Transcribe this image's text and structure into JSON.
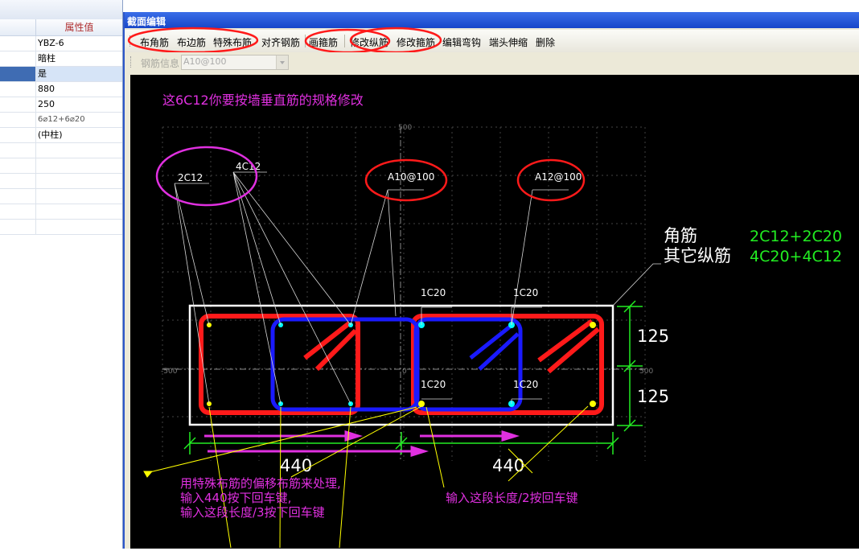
{
  "property_panel": {
    "header_value": "属性值",
    "rows": [
      {
        "value": "YBZ-6",
        "selected": false
      },
      {
        "value": "暗柱",
        "selected": false
      },
      {
        "value": "是",
        "selected": true
      },
      {
        "value": "880",
        "selected": false
      },
      {
        "value": "250",
        "selected": false
      },
      {
        "value": "6⌀12+6⌀20",
        "selected": false
      },
      {
        "value": "(中柱)",
        "selected": false
      },
      {
        "value": "",
        "selected": false
      },
      {
        "value": "",
        "selected": false
      },
      {
        "value": "",
        "selected": false
      },
      {
        "value": "",
        "selected": false
      },
      {
        "value": "",
        "selected": false
      },
      {
        "value": "",
        "selected": false
      }
    ]
  },
  "dialog": {
    "title": "截面编辑",
    "toolbar": {
      "corner_rebar": "布角筋",
      "edge_rebar": "布边筋",
      "special_rebar": "特殊布筋",
      "align_rebar": "对齐钢筋",
      "draw_stirrup": "画箍筋",
      "edit_long_rebar": "修改纵筋",
      "edit_stirrup": "修改箍筋",
      "edit_hook": "编辑弯钩",
      "end_stretch": "端头伸缩",
      "delete": "删除"
    },
    "toolbar2": {
      "rebar_info_label": "钢筋信息",
      "rebar_info_value": "A10@100"
    }
  },
  "drawing": {
    "annotation_top": "这6C12你要按墙垂直筋的规格修改",
    "label_2c12": "2C12",
    "label_4c12": "4C12",
    "label_a10": "A10@100",
    "label_a12": "A12@100",
    "label_1c20": "1C20",
    "corner_label": "角筋",
    "other_label": "其它纵筋",
    "corner_value": "2C12+2C20",
    "other_value": "4C20+4C12",
    "dim_125": "125",
    "dim_440": "440",
    "axis_500": "500",
    "axis_m500": "-500",
    "axis_0": "0",
    "note_left_1": "用特殊布筋的偏移布筋来处理,",
    "note_left_2": "输入440按下回车键,",
    "note_left_3": "输入这段长度/3按下回车键",
    "note_right": "输入这段长度/2按回车键"
  },
  "colors": {
    "red": "#ff1a1a",
    "blue": "#1a1aff",
    "magenta": "#e030e0",
    "green": "#22ee22",
    "yellow": "#ffff00",
    "title_blue": "#1746c9"
  }
}
